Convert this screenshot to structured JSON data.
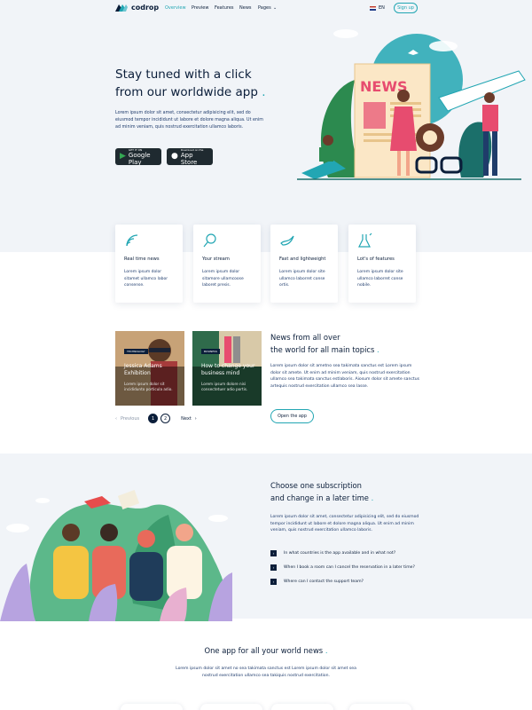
{
  "header": {
    "logo": "codrop",
    "nav": [
      "Overview",
      "Preview",
      "Features",
      "News",
      "Pages"
    ],
    "lang": "EN",
    "signup": "Sign up"
  },
  "hero": {
    "title_line1": "Stay tuned with a click",
    "title_line2": "from our worldwide app",
    "description": "Lorem ipsum dolor sit amet, consectetur adipisicing elit, sed do eiusmod tempor incididunt ut labore et dolore magna aliqua. Ut enim ad minim veniam, quis nostrud exercitation ullamco laboris.",
    "google_small": "GET IT ON",
    "google_big": "Google Play",
    "apple_small": "Download on the",
    "apple_big": "App Store",
    "news_sign": "NEWS"
  },
  "features": [
    {
      "title": "Real time news",
      "text": "Lorem ipsum dolor sitamet ullamco labor consense."
    },
    {
      "title": "Your stream",
      "text": "Lorem ipsum dolor sitamore ullamcoose laboret presis."
    },
    {
      "title": "Fast and lightweight",
      "text": "Lorem ipsum dolor site ullamco laborret conse ortis."
    },
    {
      "title": "Lot's of features",
      "text": "Lorem ipsum dolor site ullamco laborret conse nobile."
    }
  ],
  "news": {
    "cards": [
      {
        "tag": "TECHNOLOGY",
        "title": "Jessica Adams Exhibition",
        "text": "Lorem ipsum dolor sit incididunto porticula adio."
      },
      {
        "tag": "BUSINESS",
        "title": "How to change your business mind",
        "text": "Lorem ipsum dolore nisi consectetuer adio portis."
      }
    ],
    "previous": "Previous",
    "pages": [
      "1",
      "2"
    ],
    "next": "Next",
    "title_line1": "News from all over",
    "title_line2": "the world for all main topics",
    "description": "Lorem ipsum dolor sit ametno sea takimata sanctus est Lorem ipsum dolor sit amete. Ut enim ad minim veniam, quis nostrud exercitation ullamco sea takimata sanctus estlaboris. Aiosum dolor sit amete sanctus artequis nostrud exercitation ullamco sea lasse.",
    "button": "Open the app"
  },
  "subscription": {
    "title_line1": "Choose one subscription",
    "title_line2": "and change in a later time",
    "description": "Lorem ipsum dolor sit amet, consectetur adipisicing elit, sed do eiusmod tempor incididunt ut labore et dolore magna aliqua. Ut enim ad minim veniam, quis nostrud exercitation ullamco laboris.",
    "faqs": [
      "In what countries is the app available and in what not?",
      "When I book a room can I cancel the reservation in a later time?",
      "Where can I contact the support team?"
    ]
  },
  "bottom": {
    "title": "One app for all your world news",
    "description": "Lorem ipsum dolor sit amet no sea takimata sanctus est Lorem ipsum dolor sit amet sea nostrud exercitation ullamco sea takiquis nostrud exercitation."
  },
  "colors": {
    "accent": "#22a6b3",
    "navy": "#0b1e3a",
    "light_bg": "#f1f4f8"
  }
}
